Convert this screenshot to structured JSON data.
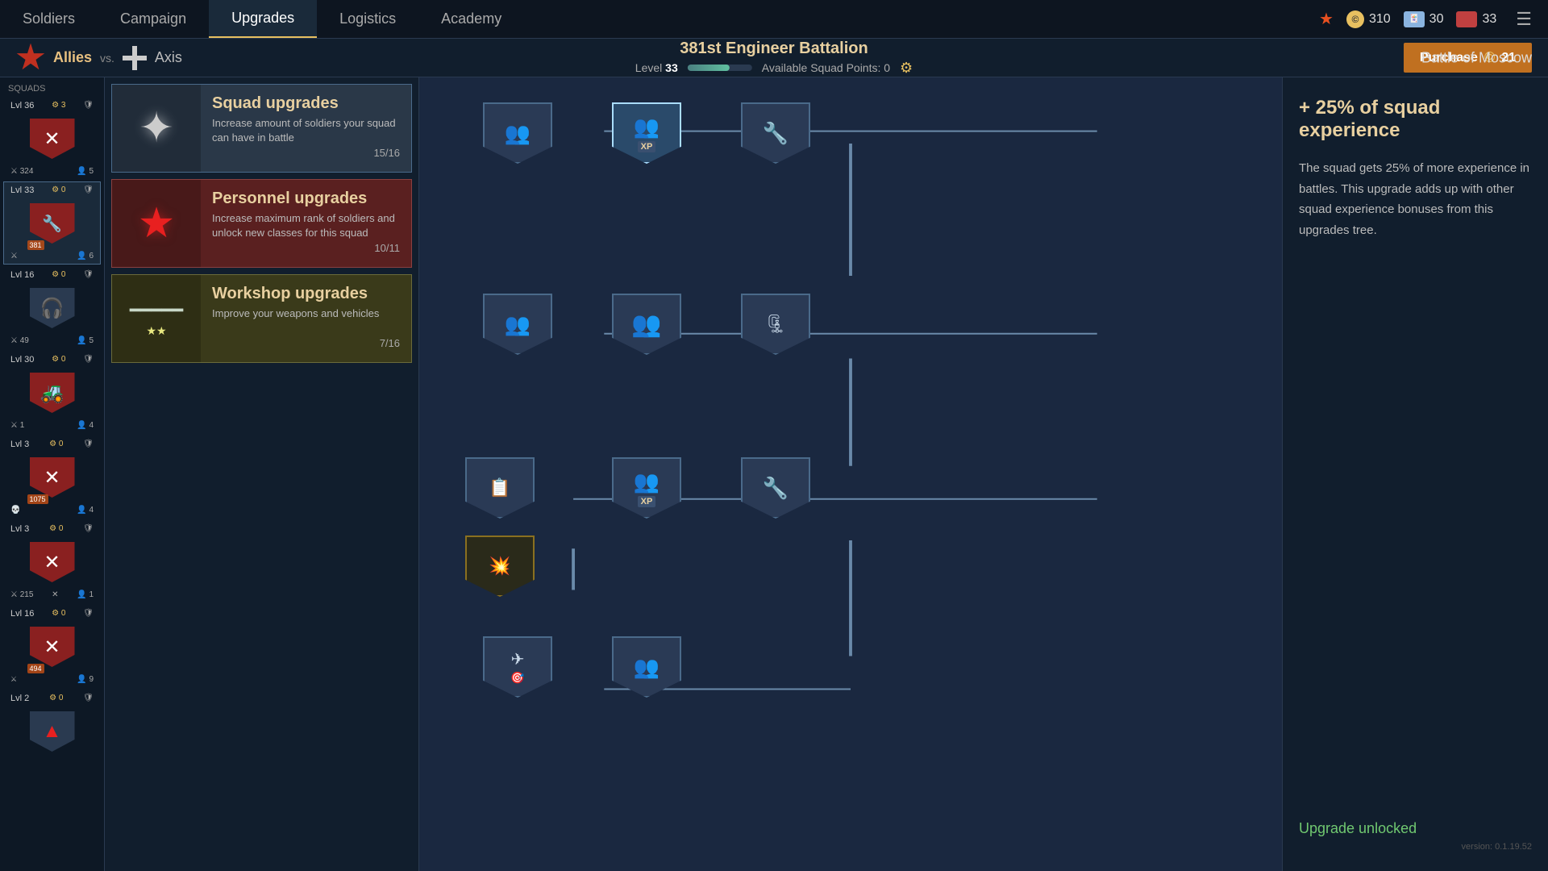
{
  "nav": {
    "items": [
      "Soldiers",
      "Campaign",
      "Upgrades",
      "Logistics",
      "Academy"
    ],
    "active": "Upgrades",
    "currency": {
      "coins": "310",
      "cards": "30",
      "books": "33"
    }
  },
  "header": {
    "faction_allies": "Allies",
    "vs": "vs.",
    "faction_axis": "Axis",
    "battalion_name": "381st Engineer Battalion",
    "level_label": "Level",
    "level_num": "33",
    "squad_points_label": "Available Squad Points: 0",
    "purchase_label": "Purchase",
    "purchase_num": "21",
    "battle_name": "Battle of Moscow"
  },
  "squads": {
    "label": "Squads",
    "items": [
      {
        "level": "Lvl 36",
        "xp": "3",
        "score": "324",
        "soldiers": "5"
      },
      {
        "level": "Lvl 33",
        "xp": "0",
        "score": "381",
        "soldiers": "6",
        "active": true
      },
      {
        "level": "Lvl 16",
        "xp": "0",
        "score": "49",
        "soldiers": "5"
      },
      {
        "level": "Lvl 30",
        "xp": "0",
        "score": "1",
        "soldiers": "4"
      },
      {
        "level": "Lvl 3",
        "xp": "0",
        "score": "1075",
        "soldiers": "4"
      },
      {
        "level": "Lvl 3",
        "xp": "0",
        "score": "215",
        "soldiers": "1"
      },
      {
        "level": "Lvl 16",
        "xp": "0",
        "score": "494",
        "soldiers": "9"
      },
      {
        "level": "Lvl 2",
        "xp": "0",
        "score": "",
        "soldiers": ""
      }
    ]
  },
  "upgrade_categories": [
    {
      "id": "squad",
      "title": "Squad upgrades",
      "description": "Increase amount of soldiers your squad can have in battle",
      "progress": "15/16",
      "style": "squad"
    },
    {
      "id": "personnel",
      "title": "Personnel upgrades",
      "description": "Increase maximum rank of soldiers and unlock new classes for this squad",
      "progress": "10/11",
      "style": "personnel"
    },
    {
      "id": "workshop",
      "title": "Workshop upgrades",
      "description": "Improve your weapons and vehicles",
      "progress": "7/16",
      "style": "workshop"
    }
  ],
  "info_panel": {
    "title": "+ 25% of squad experience",
    "description": "The squad gets 25% of more experience in battles. This upgrade adds up with other squad experience bonuses from this upgrades tree.",
    "unlocked_label": "Upgrade unlocked",
    "version": "version: 0.1.19.52"
  }
}
